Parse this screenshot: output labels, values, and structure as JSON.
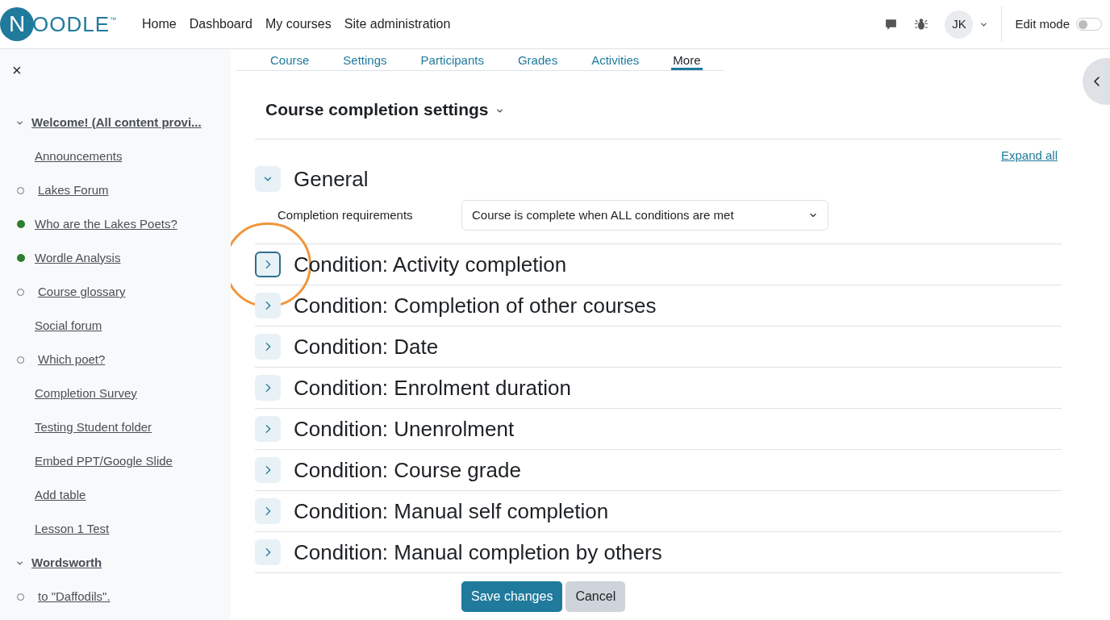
{
  "header": {
    "logo": {
      "letter": "N",
      "rest": "OODLE",
      "mark": "™"
    },
    "nav": [
      "Home",
      "Dashboard",
      "My courses",
      "Site administration"
    ],
    "avatar": "JK",
    "edit_mode": {
      "label": "Edit mode",
      "on": false
    }
  },
  "sidebar": {
    "close": "×",
    "items": [
      {
        "kind": "section",
        "label": "Welcome! (All content provi...",
        "expanded": true
      },
      {
        "kind": "activity",
        "label": "Announcements",
        "tracked": false
      },
      {
        "kind": "activity",
        "label": "Lakes Forum",
        "tracked": true,
        "completed": false
      },
      {
        "kind": "activity",
        "label": "Who are the Lakes Poets?",
        "tracked": true,
        "completed": true
      },
      {
        "kind": "activity",
        "label": "Wordle Analysis",
        "tracked": true,
        "completed": true
      },
      {
        "kind": "activity",
        "label": "Course glossary",
        "tracked": true,
        "completed": false
      },
      {
        "kind": "activity",
        "label": "Social forum",
        "tracked": false
      },
      {
        "kind": "activity",
        "label": "Which poet?",
        "tracked": true,
        "completed": false
      },
      {
        "kind": "activity",
        "label": "Completion Survey",
        "tracked": false
      },
      {
        "kind": "activity",
        "label": "Testing Student folder",
        "tracked": false
      },
      {
        "kind": "activity",
        "label": "Embed PPT/Google Slide",
        "tracked": false
      },
      {
        "kind": "activity",
        "label": "Add table",
        "tracked": false
      },
      {
        "kind": "activity",
        "label": "Lesson 1 Test",
        "tracked": false
      },
      {
        "kind": "section",
        "label": "Wordsworth",
        "expanded": true
      },
      {
        "kind": "activity",
        "label": "to \"Daffodils\".",
        "tracked": true,
        "completed": false
      }
    ]
  },
  "tabs": [
    {
      "label": "Course",
      "selected": false
    },
    {
      "label": "Settings",
      "selected": false
    },
    {
      "label": "Participants",
      "selected": false
    },
    {
      "label": "Grades",
      "selected": false
    },
    {
      "label": "Activities",
      "selected": false
    },
    {
      "label": "More",
      "selected": true
    }
  ],
  "page_title": "Course completion settings",
  "expand_all": "Expand all",
  "sections": [
    {
      "title": "General",
      "expanded": true,
      "highlighted": false,
      "fields": [
        {
          "label": "Completion requirements",
          "value": "Course is complete when ALL conditions are met"
        }
      ]
    },
    {
      "title": "Condition: Activity completion",
      "expanded": false,
      "highlighted": true
    },
    {
      "title": "Condition: Completion of other courses",
      "expanded": false,
      "highlighted": false
    },
    {
      "title": "Condition: Date",
      "expanded": false,
      "highlighted": false
    },
    {
      "title": "Condition: Enrolment duration",
      "expanded": false,
      "highlighted": false
    },
    {
      "title": "Condition: Unenrolment",
      "expanded": false,
      "highlighted": false
    },
    {
      "title": "Condition: Course grade",
      "expanded": false,
      "highlighted": false
    },
    {
      "title": "Condition: Manual self completion",
      "expanded": false,
      "highlighted": false
    },
    {
      "title": "Condition: Manual completion by others",
      "expanded": false,
      "highlighted": false
    }
  ],
  "buttons": [
    {
      "label": "Save changes",
      "kind": "primary"
    },
    {
      "label": "Cancel",
      "kind": "secondary"
    }
  ]
}
